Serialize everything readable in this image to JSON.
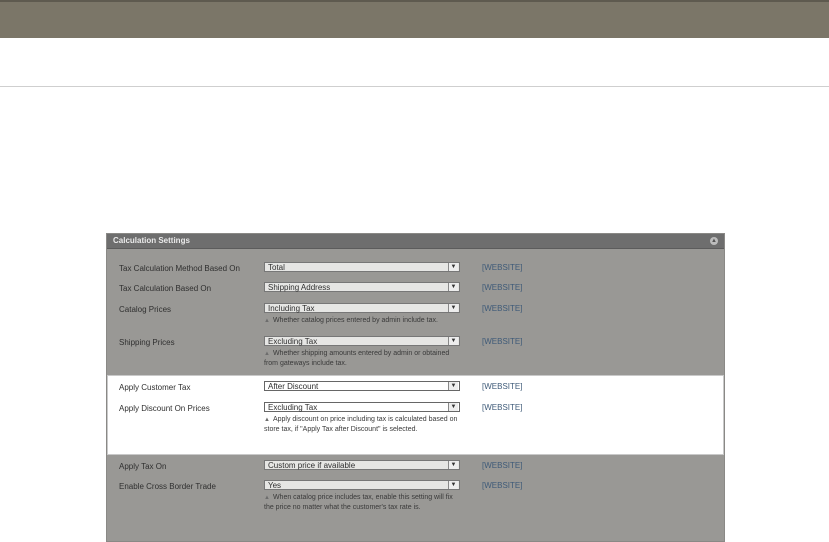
{
  "panel": {
    "title": "Calculation Settings"
  },
  "rows": [
    {
      "label": "Tax Calculation Method Based On",
      "value": "Total",
      "scope": "[WEBSITE]"
    },
    {
      "label": "Tax Calculation Based On",
      "value": "Shipping Address",
      "scope": "[WEBSITE]"
    },
    {
      "label": "Catalog Prices",
      "value": "Including Tax",
      "scope": "[WEBSITE]",
      "hint": "Whether catalog prices entered by admin include tax."
    },
    {
      "label": "Shipping Prices",
      "value": "Excluding Tax",
      "scope": "[WEBSITE]",
      "hint": "Whether shipping amounts entered by admin or obtained from gateways include tax."
    },
    {
      "label": "Apply Customer Tax",
      "value": "After Discount",
      "scope": "[WEBSITE]"
    },
    {
      "label": "Apply Discount On Prices",
      "value": "Excluding Tax",
      "scope": "[WEBSITE]",
      "hint": "Apply discount on price including tax is calculated based on store tax, if \"Apply Tax after Discount\" is selected."
    },
    {
      "label": "Apply Tax On",
      "value": "Custom price if available",
      "scope": "[WEBSITE]"
    },
    {
      "label": "Enable Cross Border Trade",
      "value": "Yes",
      "scope": "[WEBSITE]",
      "hint": "When catalog price includes tax, enable this setting will fix the price no matter what the customer's tax rate is."
    }
  ],
  "icons": {
    "collapse": "collapse-icon",
    "dropdown": "chevron-down-icon",
    "hint": "hint-arrow-icon"
  }
}
